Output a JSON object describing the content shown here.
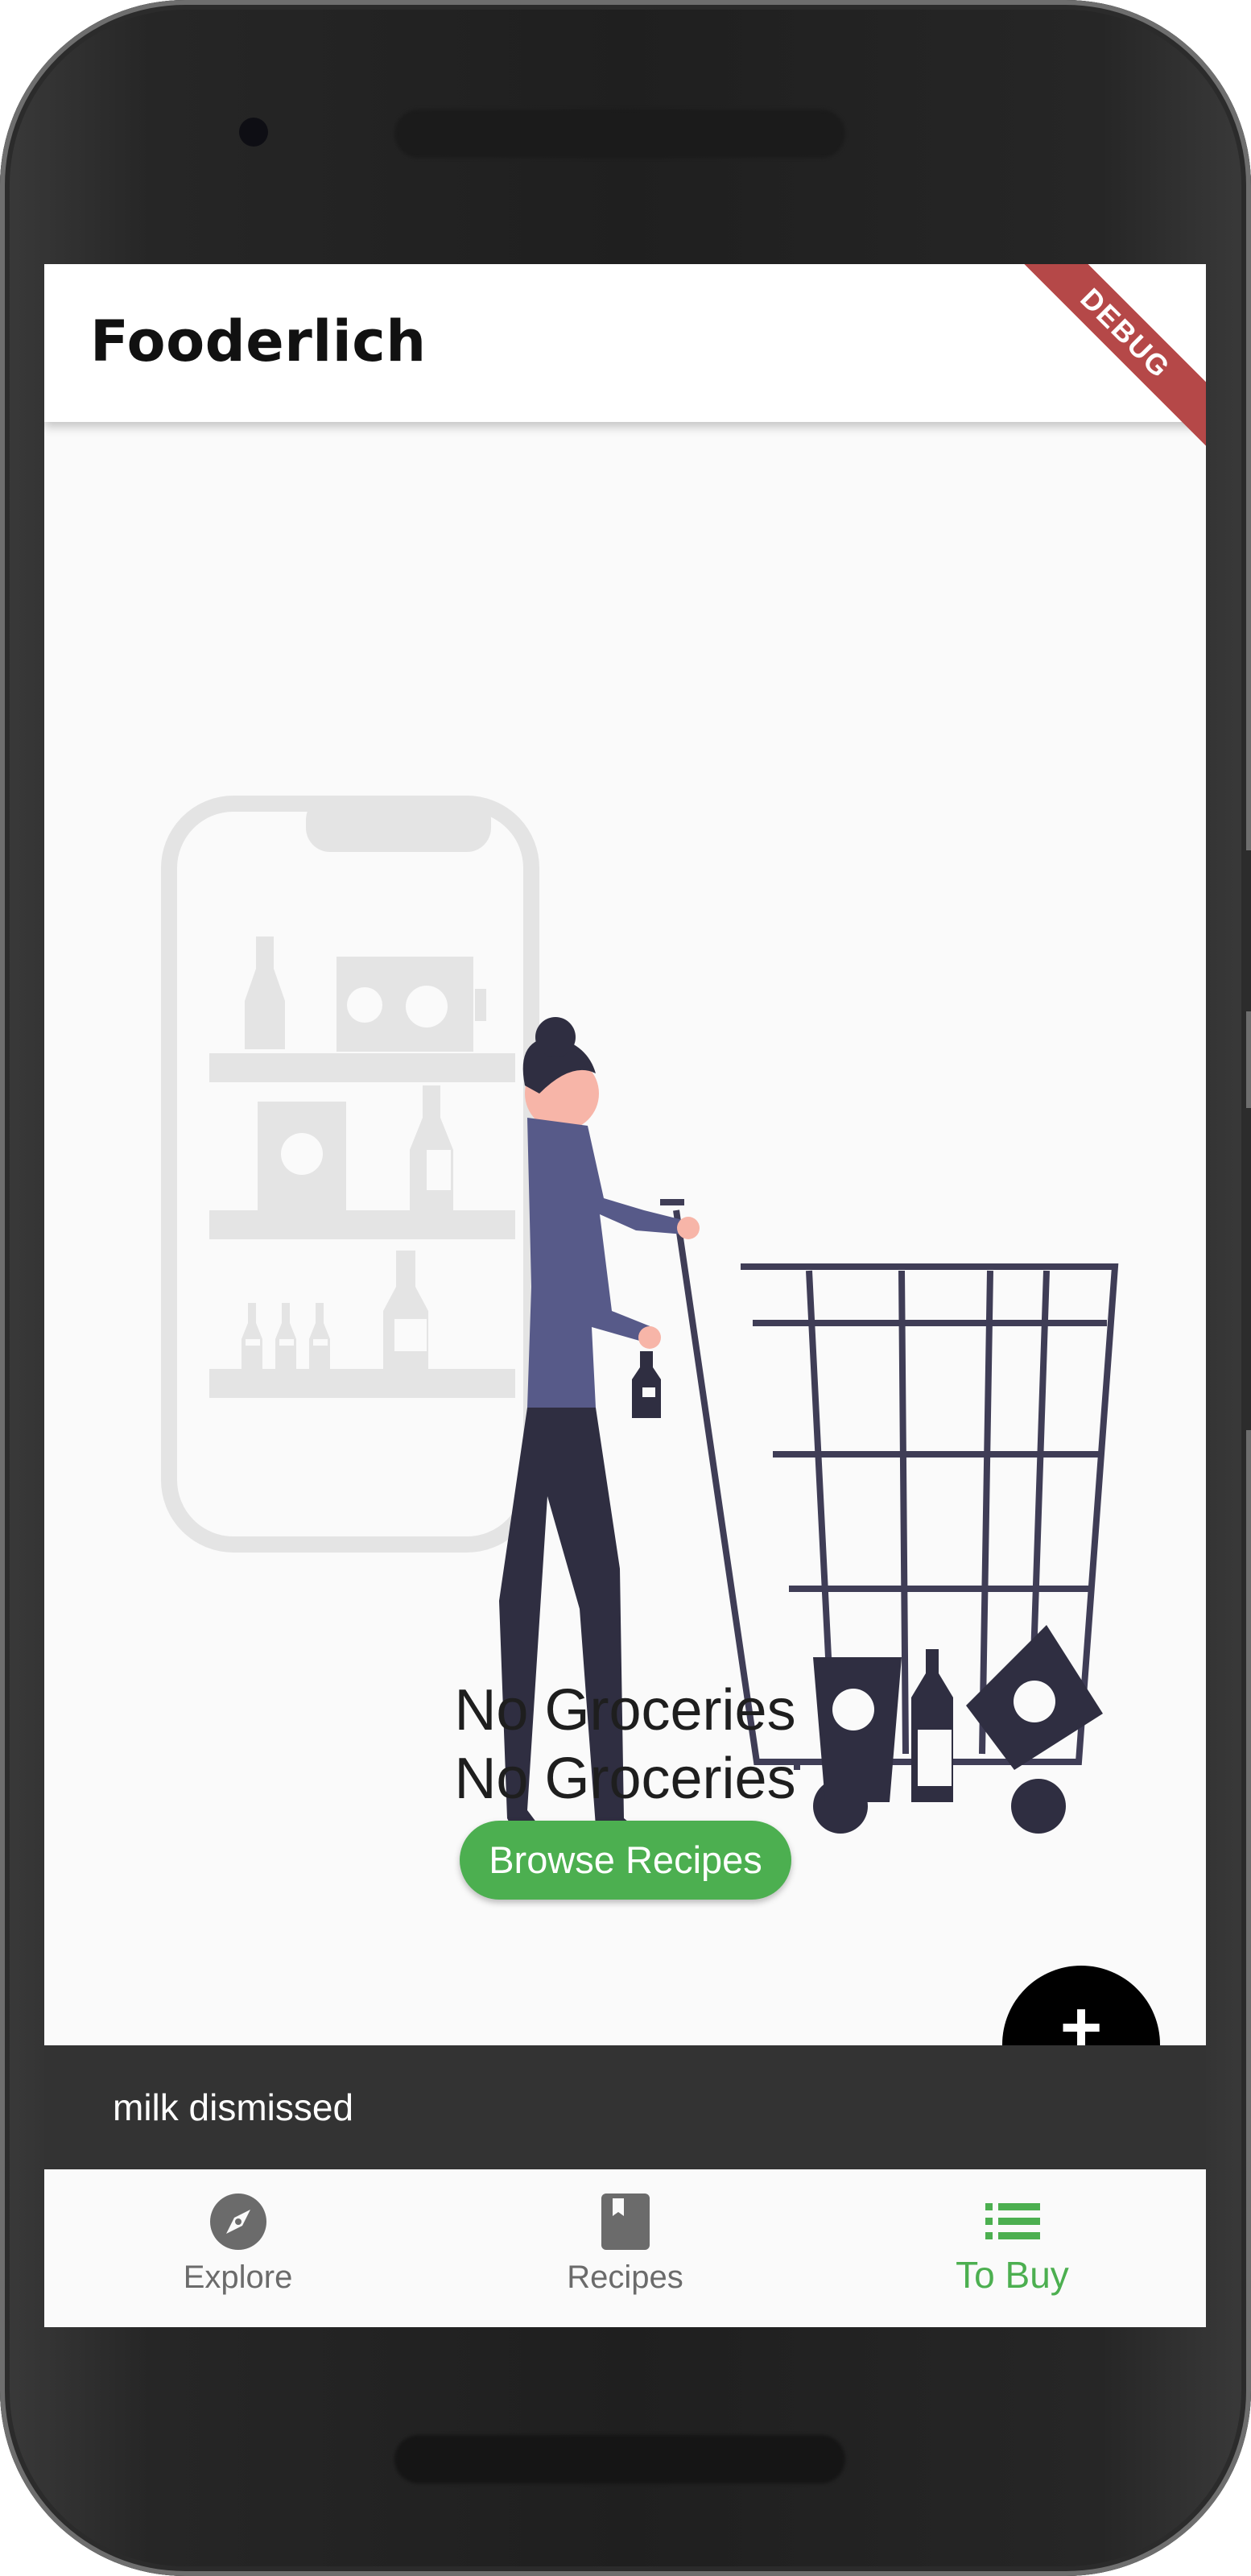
{
  "app": {
    "title": "Fooderlich",
    "debug_banner": "DEBUG"
  },
  "empty_state": {
    "title_line_1": "No Groceries",
    "title_line_2": "No Groceries",
    "button_label": "Browse Recipes",
    "illustration": "person-with-shopping-cart"
  },
  "fab": {
    "icon": "add-icon",
    "label": "+"
  },
  "snackbar": {
    "message": "milk dismissed"
  },
  "bottom_nav": {
    "items": [
      {
        "label": "Explore",
        "icon": "compass-icon",
        "selected": false
      },
      {
        "label": "Recipes",
        "icon": "book-icon",
        "selected": false
      },
      {
        "label": "To Buy",
        "icon": "list-icon",
        "selected": true
      }
    ]
  },
  "colors": {
    "accent": "#4caf50",
    "inactive": "#6b6b6b",
    "snackbar": "#333333",
    "debug": "#b54848"
  }
}
